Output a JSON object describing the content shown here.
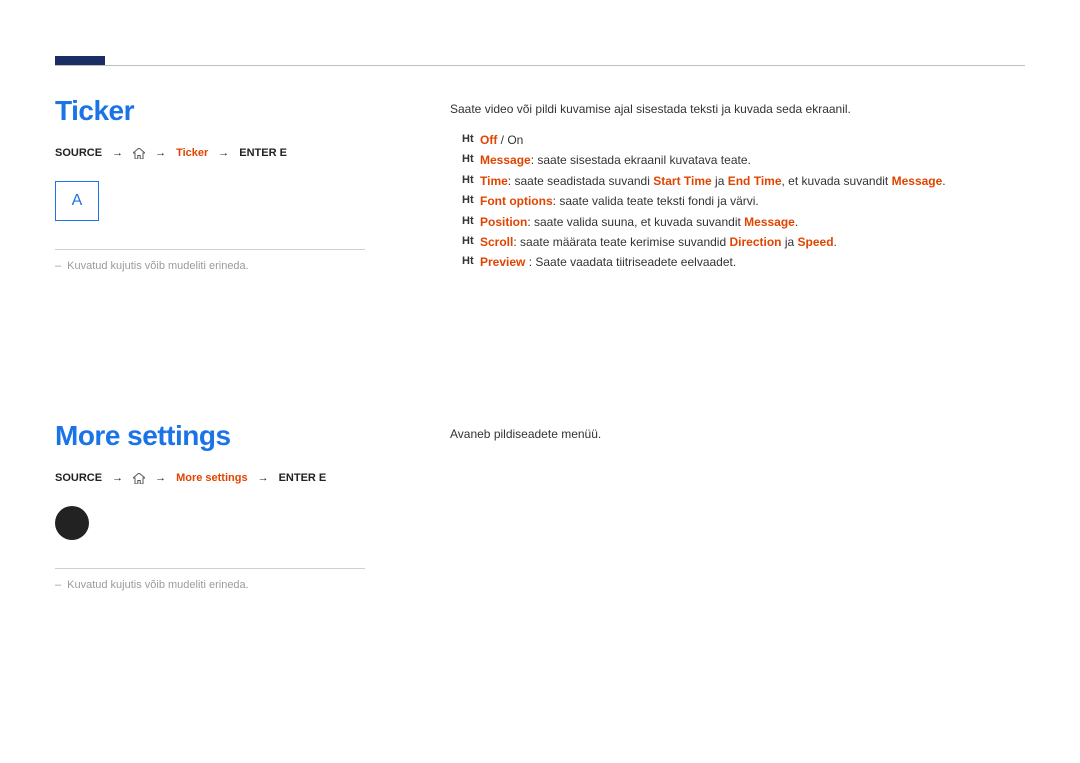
{
  "section1": {
    "title": "Ticker",
    "path": {
      "source": "SOURCE",
      "label": "Ticker",
      "enter": "ENTER E"
    },
    "panel_letter": "A",
    "note": "Kuvatud kujutis võib mudeliti erineda.",
    "intro": "Saate video või pildi kuvamise ajal sisestada teksti ja kuvada seda ekraanil.",
    "items": [
      {
        "label": "Off",
        "tail": " / On"
      },
      {
        "label": "Message",
        "tail": ": saate sisestada ekraanil kuvatava teate."
      },
      {
        "label": "Time",
        "tail_parts": [
          ": saate seadistada suvandi ",
          {
            "kw": "Start Time"
          },
          " ja ",
          {
            "kw": "End Time"
          },
          ", et kuvada suvandit ",
          {
            "kw": "Message"
          },
          "."
        ]
      },
      {
        "label": "Font options",
        "tail": ": saate valida teate teksti fondi ja värvi."
      },
      {
        "label": "Position",
        "tail_parts": [
          ": saate valida suuna, et kuvada suvandit ",
          {
            "kw": "Message"
          },
          "."
        ]
      },
      {
        "label": "Scroll",
        "tail_parts": [
          ": saate määrata teate kerimise suvandid ",
          {
            "kw": "Direction"
          },
          " ja ",
          {
            "kw": "Speed"
          },
          "."
        ]
      },
      {
        "label": "Preview",
        "tail": " : Saate vaadata tiitriseadete eelvaadet."
      }
    ]
  },
  "section2": {
    "title": "More settings",
    "path": {
      "source": "SOURCE",
      "label": "More settings",
      "enter": "ENTER E"
    },
    "note": "Kuvatud kujutis võib mudeliti erineda.",
    "intro": "Avaneb pildiseadete menüü."
  },
  "bullet": "Ht"
}
